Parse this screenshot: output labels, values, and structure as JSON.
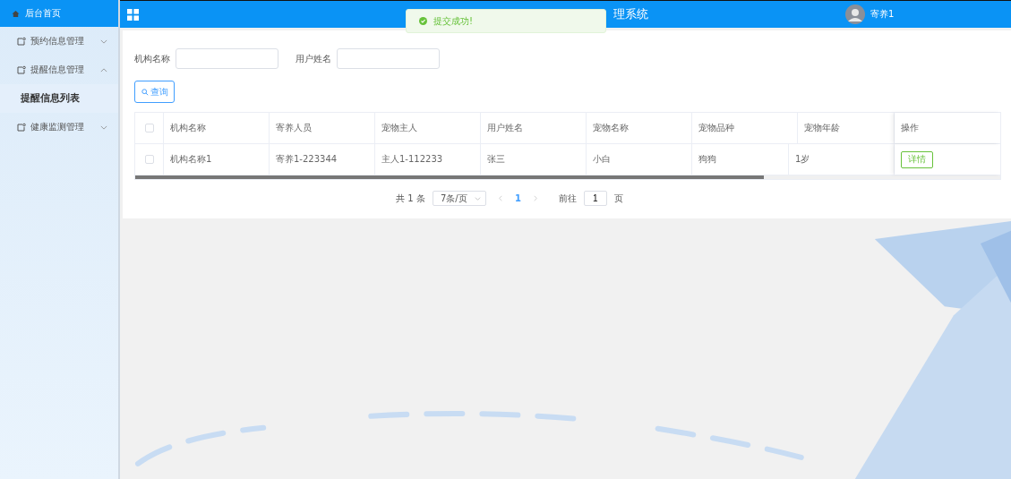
{
  "sidebar": {
    "home": "后台首页",
    "menus": [
      {
        "label": "预约信息管理",
        "expanded": false
      },
      {
        "label": "提醒信息管理",
        "expanded": true,
        "children": [
          {
            "label": "提醒信息列表",
            "selected": true
          }
        ]
      },
      {
        "label": "健康监测管理",
        "expanded": false
      }
    ]
  },
  "header": {
    "title": "理系统",
    "user": "寄养1"
  },
  "toast": {
    "kind": "success",
    "message": "提交成功!"
  },
  "search": {
    "fields": [
      {
        "label": "机构名称"
      },
      {
        "label": "用户姓名"
      }
    ],
    "button": "查询"
  },
  "table": {
    "all_checked": false,
    "columns": [
      "机构名称",
      "寄养人员",
      "宠物主人",
      "用户姓名",
      "宠物名称",
      "宠物品种",
      "宠物年龄",
      "操作"
    ],
    "rows": [
      {
        "checked": false,
        "cells": [
          "机构名称1",
          "寄养1-223344",
          "主人1-112233",
          "张三",
          "小白",
          "狗狗",
          "1岁"
        ],
        "action": "详情"
      }
    ]
  },
  "pagination": {
    "total": "共 1 条",
    "page_size": "7条/页",
    "pages": [
      {
        "label": "1",
        "selected": true
      }
    ],
    "goto_label": "前往",
    "goto_value": "1",
    "page_suffix": "页"
  }
}
